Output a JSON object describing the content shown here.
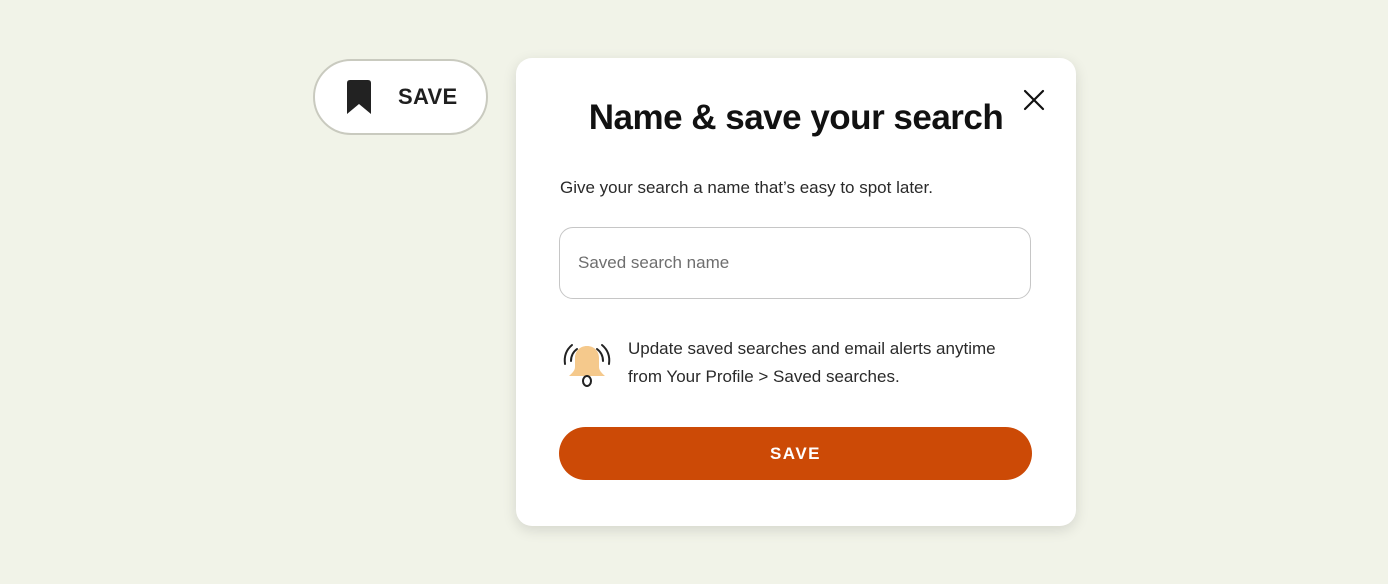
{
  "save_pill": {
    "icon": "bookmark-icon",
    "label": "SAVE"
  },
  "modal": {
    "title": "Name & save your search",
    "description": "Give your search a name that’s easy to spot later.",
    "close_icon": "close-icon",
    "input": {
      "placeholder": "Saved search name",
      "value": ""
    },
    "alert": {
      "icon": "ringing-bell-icon",
      "text": "Update saved searches and email alerts anytime from Your Profile > Saved searches."
    },
    "submit_label": "SAVE"
  },
  "colors": {
    "page_background": "#f1f3e8",
    "accent": "#cc4a06",
    "bell": "#f5c98c"
  }
}
